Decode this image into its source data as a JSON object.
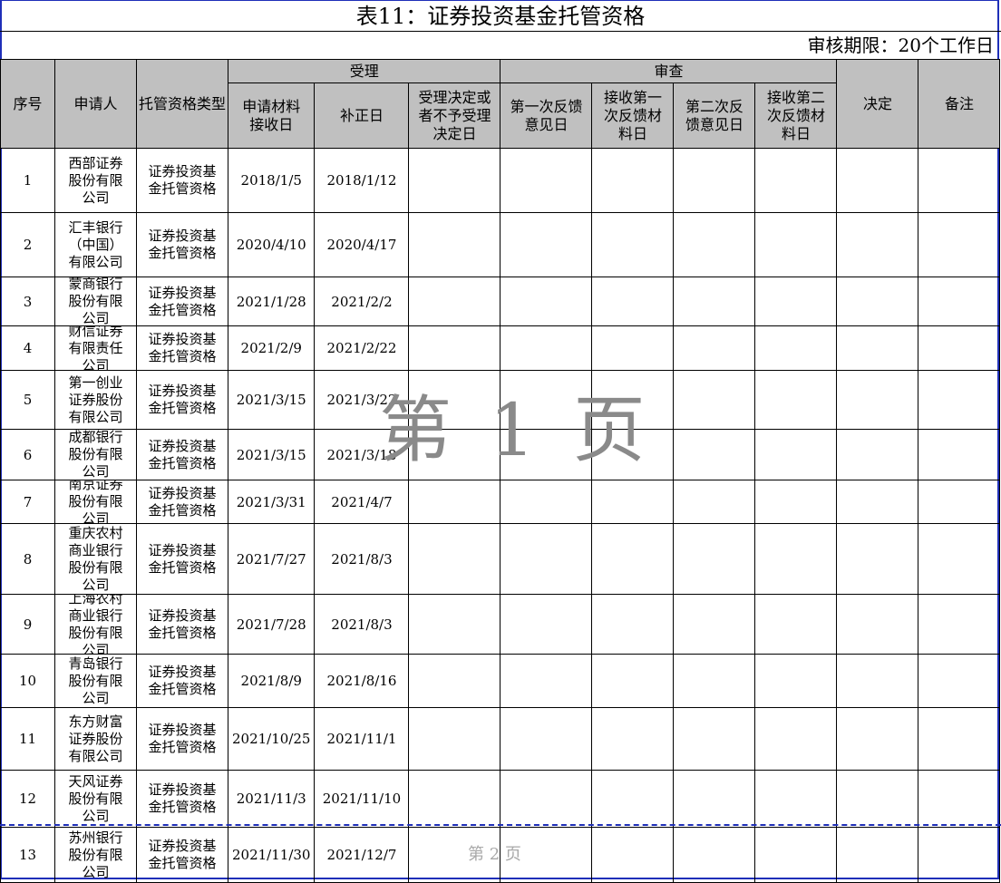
{
  "sheet": {
    "title": "表11：证券投资基金托管资格",
    "period": "审核期限：20个工作日"
  },
  "headers": {
    "seq": "序号",
    "applicant": "申请人",
    "qualification_type": "托管资格类型",
    "acceptance_group": "受理",
    "review_group": "审查",
    "material_received": "申请材料接收日",
    "correction": "补正日",
    "accept_decision": "受理决定或者不予受理决定日",
    "first_feedback": "第一次反馈意见日",
    "first_feedback_received": "接收第一次反馈材料日",
    "second_feedback": "第二次反馈意见日",
    "second_feedback_received": "接收第二次反馈材料日",
    "decision": "决定",
    "remark": "备注"
  },
  "rows": [
    {
      "seq": "1",
      "applicant": "西部证券股份有限公司",
      "type": "证券投资基金托管资格",
      "received": "2018/1/5",
      "correction": "2018/1/12"
    },
    {
      "seq": "2",
      "applicant": "汇丰银行（中国）有限公司",
      "type": "证券投资基金托管资格",
      "received": "2020/4/10",
      "correction": "2020/4/17"
    },
    {
      "seq": "3",
      "applicant": "蒙商银行股份有限公司",
      "type": "证券投资基金托管资格",
      "received": "2021/1/28",
      "correction": "2021/2/2"
    },
    {
      "seq": "4",
      "applicant": "财信证券有限责任公司",
      "type": "证券投资基金托管资格",
      "received": "2021/2/9",
      "correction": "2021/2/22"
    },
    {
      "seq": "5",
      "applicant": "第一创业证券股份有限公司",
      "type": "证券投资基金托管资格",
      "received": "2021/3/15",
      "correction": "2021/3/22"
    },
    {
      "seq": "6",
      "applicant": "成都银行股份有限公司",
      "type": "证券投资基金托管资格",
      "received": "2021/3/15",
      "correction": "2021/3/18"
    },
    {
      "seq": "7",
      "applicant": "南京证券股份有限公司",
      "type": "证券投资基金托管资格",
      "received": "2021/3/31",
      "correction": "2021/4/7"
    },
    {
      "seq": "8",
      "applicant": "重庆农村商业银行股份有限公司",
      "type": "证券投资基金托管资格",
      "received": "2021/7/27",
      "correction": "2021/8/3"
    },
    {
      "seq": "9",
      "applicant": "上海农村商业银行股份有限公司",
      "type": "证券投资基金托管资格",
      "received": "2021/7/28",
      "correction": "2021/8/3"
    },
    {
      "seq": "10",
      "applicant": "青岛银行股份有限公司",
      "type": "证券投资基金托管资格",
      "received": "2021/8/9",
      "correction": "2021/8/16"
    },
    {
      "seq": "11",
      "applicant": "东方财富证券股份有限公司",
      "type": "证券投资基金托管资格",
      "received": "2021/10/25",
      "correction": "2021/11/1"
    },
    {
      "seq": "12",
      "applicant": "天风证券股份有限公司",
      "type": "证券投资基金托管资格",
      "received": "2021/11/3",
      "correction": "2021/11/10"
    },
    {
      "seq": "13",
      "applicant": "苏州银行股份有限公司",
      "type": "证券投资基金托管资格",
      "received": "2021/11/30",
      "correction": "2021/12/7"
    }
  ],
  "watermarks": {
    "page1": "第 1 页",
    "page2": "第 2 页"
  },
  "colors": {
    "header_bg": "#c0c0c0",
    "frame_border": "#1f2fb8",
    "watermark": "#8a8a8a"
  }
}
